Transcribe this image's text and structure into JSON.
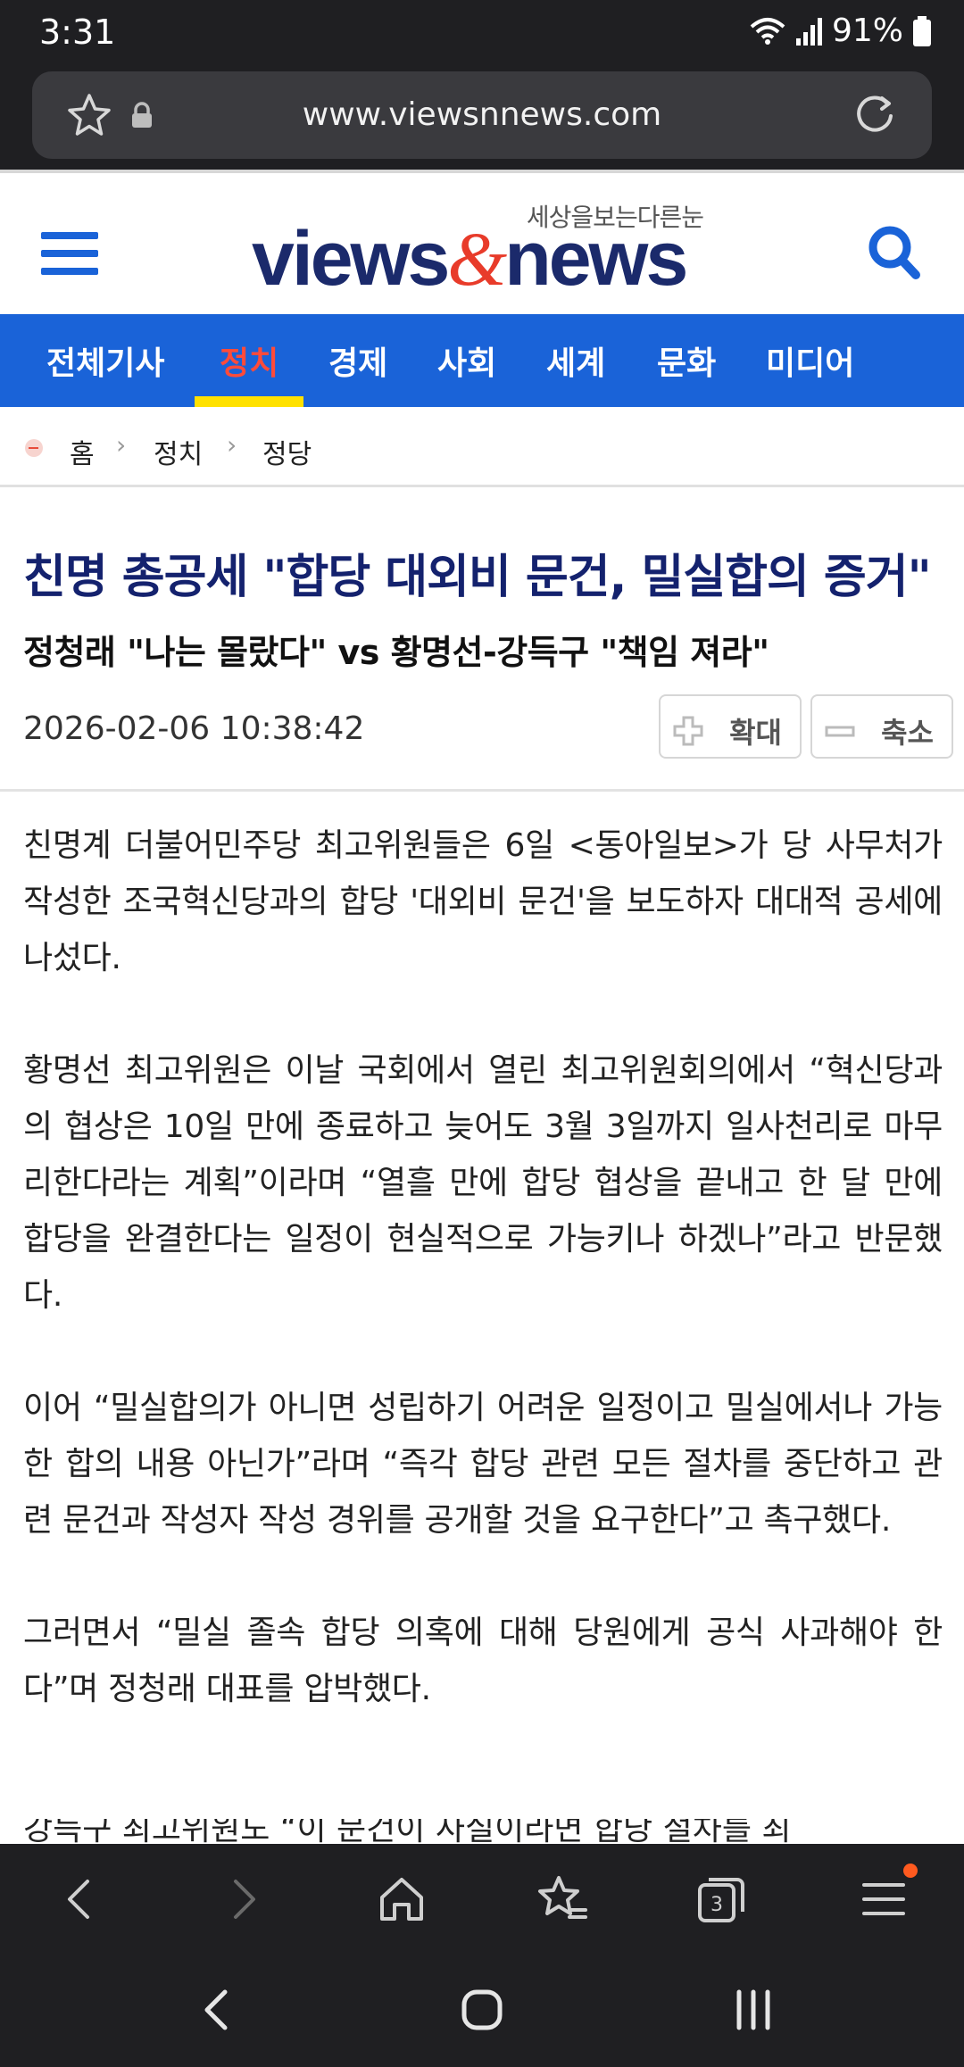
{
  "status": {
    "time": "3:31",
    "battery": "91%"
  },
  "browser": {
    "url": "www.viewsnnews.com",
    "tab_count": "3"
  },
  "site": {
    "logo_tagline": "세상을보는다른눈",
    "logo_views": "views",
    "logo_amp": "&",
    "logo_news": "news",
    "brand_blue": "#1a63d8",
    "brand_red": "#e83b2a"
  },
  "nav": {
    "items": [
      "전체기사",
      "정치",
      "경제",
      "사회",
      "세계",
      "문화",
      "미디어"
    ],
    "active": "정치"
  },
  "breadcrumb": [
    "홈",
    "정치",
    "정당"
  ],
  "article": {
    "headline": "친명 총공세 \"합당 대외비 문건, 밀실합의 증거\"",
    "subhead": "정청래 \"나는 몰랐다\" vs 황명선-강득구 \"책임 져라\"",
    "datetime": "2026-02-06 10:38:42",
    "zoom_in_label": "확대",
    "zoom_out_label": "축소",
    "paragraphs": [
      "친명계 더불어민주당 최고위원들은 6일 <동아일보>가 당 사무처가 작성한 조국혁신당과의 합당 '대외비 문건'을 보도하자 대대적 공세에 나섰다.",
      "황명선 최고위원은 이날 국회에서 열린 최고위원회의에서 “혁신당과의 협상은 10일 만에 종료하고 늦어도 3월 3일까지 일사천리로 마무리한다라는 계획”이라며 “열흘 만에 합당 협상을 끝내고 한 달 만에 합당을 완결한다는 일정이 현실적으로 가능키나 하겠나”라고 반문했다.",
      "이어 “밀실합의가 아니면 성립하기 어려운 일정이고 밀실에서나 가능한 합의 내용 아닌가”라며 “즉각 합당 관련 모든 절차를 중단하고 관련 문건과 작성자 작성 경위를 공개할 것을 요구한다”고 촉구했다.",
      "그러면서 “밀실 졸속 합당 의혹에 대해 당원에게 공식 사과해야 한다”며 정청래 대표를 압박했다."
    ],
    "cut_paragraph": "강득구 최고위원도 “이 문건이 사실이라면 합당 절차를 최"
  }
}
